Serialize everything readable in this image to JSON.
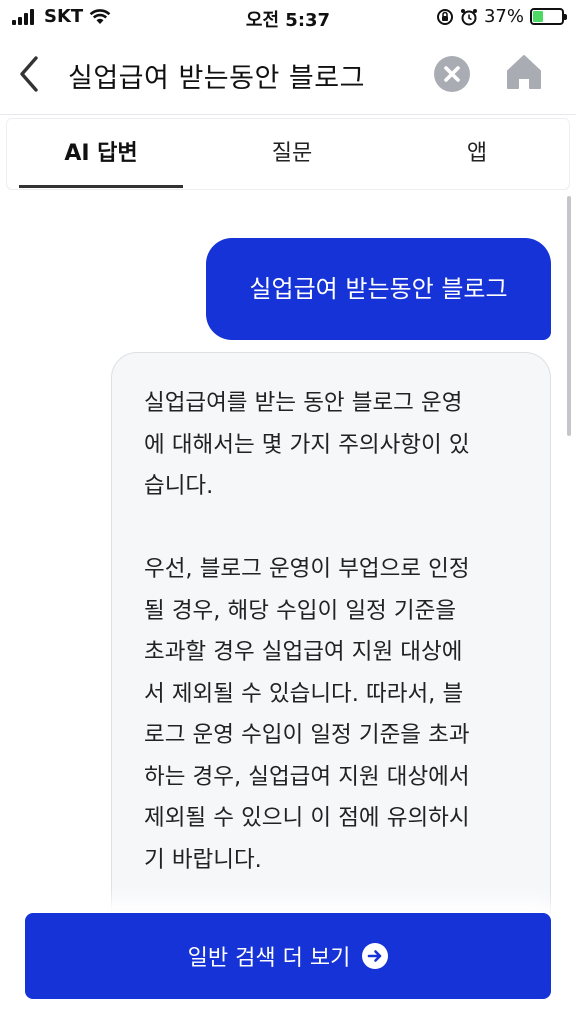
{
  "status_bar": {
    "carrier": "SKT",
    "time": "오전 5:37",
    "battery": "37%",
    "battery_level": 0.37
  },
  "header": {
    "query": "실업급여 받는동안 블로그",
    "icons": {
      "back": "chevron-left-icon",
      "clear": "close-circle-icon",
      "home": "home-icon"
    }
  },
  "tabs": [
    {
      "label": "AI 답변",
      "active": true
    },
    {
      "label": "질문",
      "active": false
    },
    {
      "label": "앱",
      "active": false
    }
  ],
  "chat": {
    "user_message": "실업급여 받는동안 블로그",
    "answer": "실업급여를 받는 동안 블로그 운영\n에 대해서는 몇 가지 주의사항이 있\n습니다.\n\n우선, 블로그 운영이 부업으로 인정\n될 경우, 해당 수입이 일정 기준을\n초과할 경우 실업급여 지원 대상에\n서 제외될 수 있습니다. 따라서, 블\n로그 운영 수입이 일정 기준을 초과\n하는 경우, 실업급여 지원 대상에서\n제외될 수 있으니 이 점에 유의하시\n기 바랍니다."
  },
  "footer": {
    "more_button_label": "일반 검색 더 보기",
    "more_button_icon": "arrow-right-circle-icon"
  },
  "colors": {
    "accent": "#1533d6",
    "card_bg": "#f6f7f9"
  }
}
